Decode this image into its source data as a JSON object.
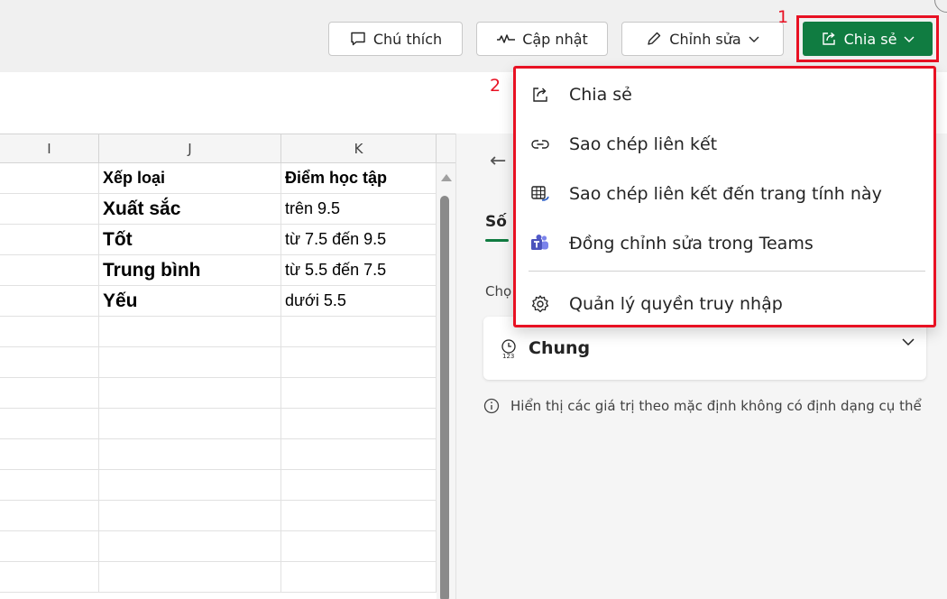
{
  "toolbar": {
    "comment_label": "Chú thích",
    "update_label": "Cập nhật",
    "edit_label": "Chỉnh sửa",
    "share_label": "Chia sẻ"
  },
  "annotations": {
    "step1": "1",
    "step2": "2"
  },
  "grid": {
    "columns": [
      "I",
      "J",
      "K"
    ],
    "rows": [
      {
        "i": "",
        "j": "Xếp loại",
        "k": "Điểm học tập"
      },
      {
        "i": "",
        "j": "Xuất sắc",
        "k": "trên 9.5"
      },
      {
        "i": "",
        "j": "Tốt",
        "k": "từ 7.5 đến 9.5"
      },
      {
        "i": "",
        "j": "Trung bình",
        "k": "từ 5.5 đến 7.5"
      },
      {
        "i": "",
        "j": "Yếu",
        "k": "dưới 5.5"
      }
    ]
  },
  "share_menu": {
    "items": [
      {
        "label": "Chia sẻ",
        "icon": "share-icon"
      },
      {
        "label": "Sao chép liên kết",
        "icon": "link-icon"
      },
      {
        "label": "Sao chép liên kết đến trang tính này",
        "icon": "sheet-link-icon"
      },
      {
        "label": "Đồng chỉnh sửa trong Teams",
        "icon": "teams-icon"
      },
      {
        "label": "Quản lý quyền truy nhập",
        "icon": "gear-icon"
      }
    ]
  },
  "pane": {
    "tab_label": "Số",
    "field_label": "Chọ",
    "format_value": "Chung",
    "info_text": "Hiển thị các giá trị theo mặc định không có định dạng cụ thể"
  },
  "colors": {
    "accent_green": "#107c41",
    "highlight_red": "#e81123"
  }
}
